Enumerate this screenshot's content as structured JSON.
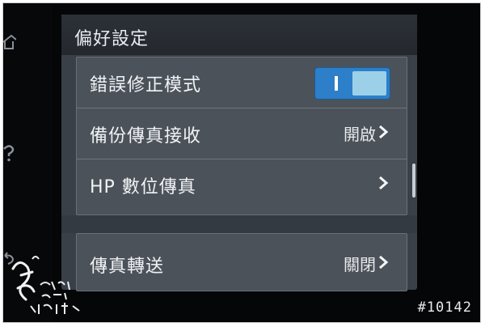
{
  "screen": {
    "title": "偏好設定"
  },
  "settings": {
    "items": [
      {
        "label": "錯誤修正模式",
        "control": "toggle",
        "toggle_state": "on",
        "toggle_symbol": "I",
        "value": ""
      },
      {
        "label": "備份傳真接收",
        "control": "chevron",
        "value": "開啟"
      },
      {
        "label": "HP 數位傳真",
        "control": "chevron",
        "value": ""
      },
      {
        "label": "傳真轉送",
        "control": "chevron",
        "value": "關閉"
      }
    ]
  },
  "photo": {
    "id_label": "#10142",
    "watermark_text": "まいちゃんのブログ 小舞の部落格"
  },
  "colors": {
    "screen_bg": "#3a4048",
    "row_bg": "#4c5259",
    "toggle_on": "#2c7fc8",
    "toggle_knob": "#9cd0e8",
    "text": "#f0f3f6"
  },
  "icons": {
    "side": [
      "home-icon",
      "help-icon",
      "back-icon"
    ],
    "row": [
      "chevron-right-icon"
    ]
  }
}
